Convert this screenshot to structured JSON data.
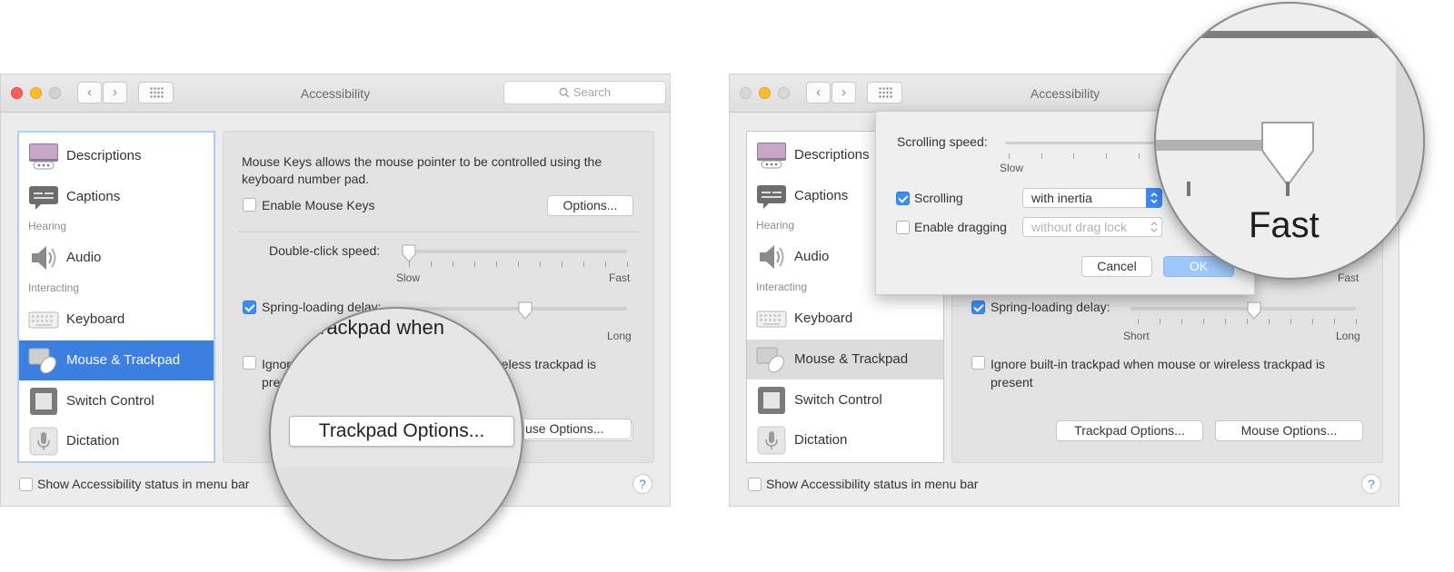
{
  "title": "Accessibility",
  "search_placeholder": "Search",
  "sidebar": {
    "items": [
      {
        "label": "Descriptions",
        "icon": "descriptions-icon"
      },
      {
        "label": "Captions",
        "icon": "captions-icon"
      },
      {
        "label": "Audio",
        "icon": "speaker-icon"
      },
      {
        "label": "Keyboard",
        "icon": "keyboard-icon"
      },
      {
        "label": "Mouse & Trackpad",
        "icon": "mouse-trackpad-icon"
      },
      {
        "label": "Switch Control",
        "icon": "switch-control-icon"
      },
      {
        "label": "Dictation",
        "icon": "microphone-icon"
      }
    ],
    "headers": [
      "Hearing",
      "Interacting"
    ],
    "selected": "Mouse & Trackpad"
  },
  "panel": {
    "mouse_keys_description": "Mouse Keys allows the mouse pointer to be controlled using the keyboard number pad.",
    "enable_mouse_keys": "Enable Mouse Keys",
    "options_button": "Options...",
    "double_click_label": "Double-click speed:",
    "double_click_value": 0.0,
    "spring_loading_label": "Spring-loading delay:",
    "spring_loading_value": 0.55,
    "slow": "Slow",
    "fast": "Fast",
    "short": "Short",
    "long": "Long",
    "ignore_trackpad": "Ignore built-in trackpad when mouse or wireless trackpad is present",
    "trackpad_options_button": "Trackpad Options...",
    "mouse_options_button": "Mouse Options..."
  },
  "status_bar": {
    "show_status": "Show Accessibility status in menu bar",
    "help": "?"
  },
  "sheet": {
    "scrolling_speed_label": "Scrolling speed:",
    "scrolling_speed_value": 1.0,
    "slow": "Slow",
    "scrolling_label": "Scrolling",
    "scrolling_value": "with inertia",
    "enable_dragging_label": "Enable dragging",
    "enable_dragging_value": "without drag lock",
    "cancel": "Cancel",
    "ok": "OK"
  },
  "magnifier1": {
    "text_top": "rackpad when",
    "button": "Trackpad Options...",
    "button_right": "use Options..."
  },
  "magnifier2": {
    "fast": "Fast"
  },
  "colors": {
    "accent": "#3b7fe0",
    "check": "#3a8ef7",
    "ok_button": "#9ec8fb"
  }
}
